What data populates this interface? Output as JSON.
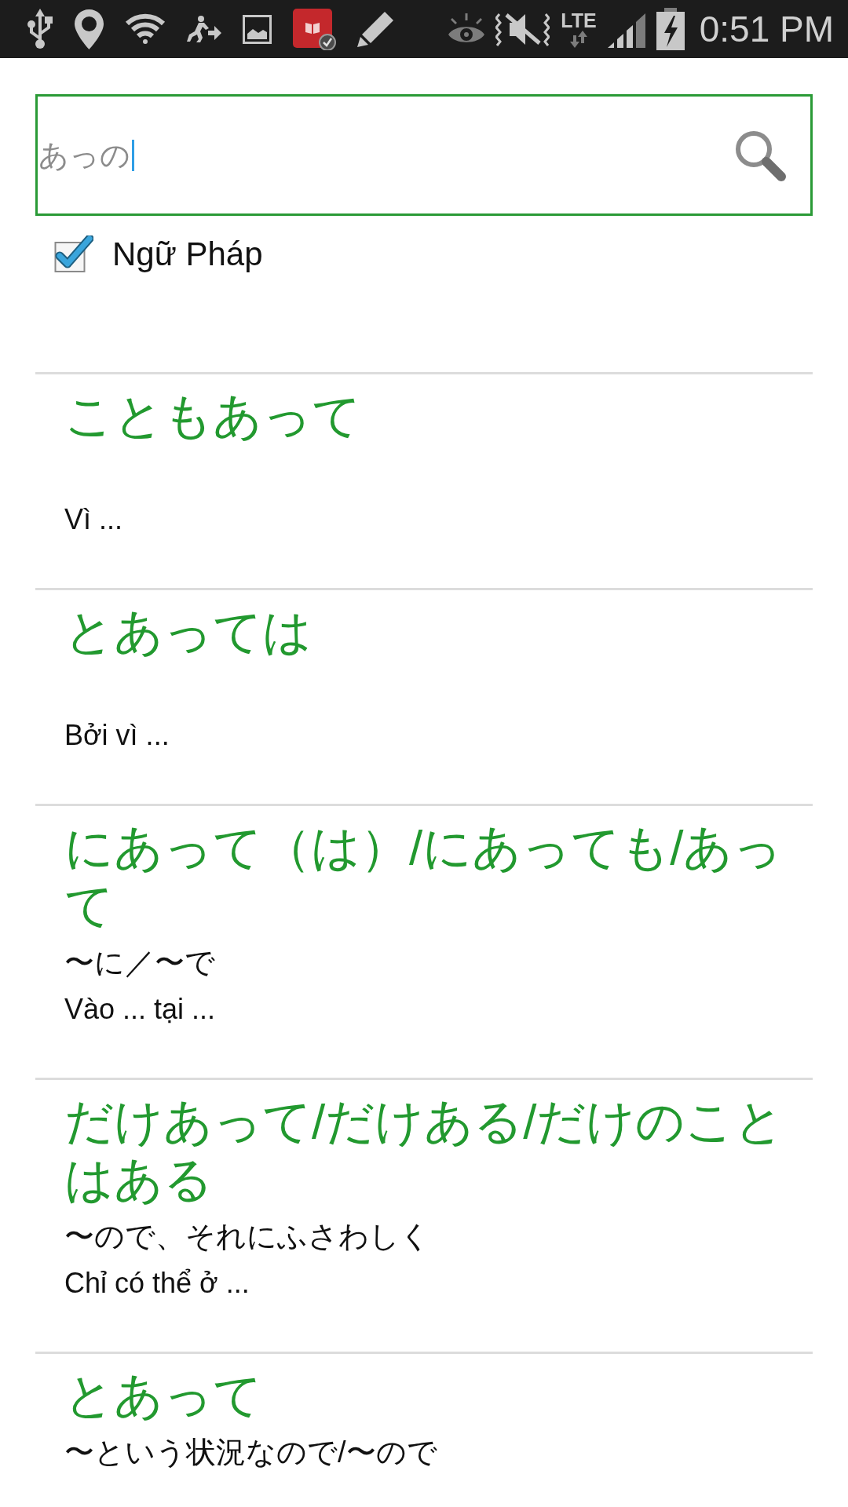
{
  "status_bar": {
    "network_type": "LTE",
    "time": "0:51 PM"
  },
  "search": {
    "value": "あっの"
  },
  "filter": {
    "label": "Ngữ Pháp",
    "checked": true
  },
  "results": [
    {
      "title": "こともあって",
      "meaning": "Vì ..."
    },
    {
      "title": "とあっては",
      "meaning": "Bởi vì ..."
    },
    {
      "title": "にあって（は）/にあっても/あって",
      "example": "〜に／〜で",
      "meaning": "Vào ... tại ..."
    },
    {
      "title": "だけあって/だけある/だけのことはある",
      "example": "〜ので、それにふさわしく",
      "meaning": "Chỉ có thể ở ..."
    },
    {
      "title": "とあって",
      "example": "〜という状況なので/〜ので"
    }
  ]
}
